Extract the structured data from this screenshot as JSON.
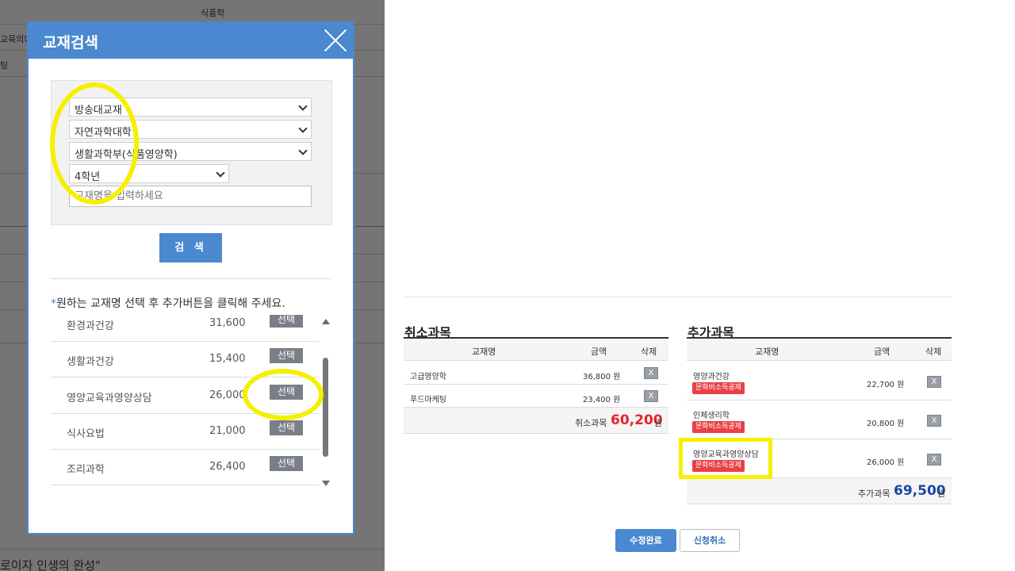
{
  "background": {
    "col_header": "식품학",
    "row_text_1": "교육의미",
    "row_text_2": "팅",
    "bottom_text": "로이자 인생의 완성\""
  },
  "modal": {
    "title": "교재검색",
    "close_icon": "close-icon",
    "filters": {
      "type": "방송대교재",
      "college": "자연과학대학",
      "department": "생활과학부(식품영양학)",
      "grade": "4학년"
    },
    "search_placeholder": "교재명을 입력하세요",
    "search_button": "검 색",
    "instruction_star": "*",
    "instruction": "원하는 교재명 선택 후 추가버튼을 클릭해 주세요.",
    "books": [
      {
        "name": "환경과건강",
        "price": "31,600",
        "select_label": "선택"
      },
      {
        "name": "생활과건강",
        "price": "15,400",
        "select_label": "선택"
      },
      {
        "name": "영양교육과영양상담",
        "price": "26,000",
        "select_label": "선택"
      },
      {
        "name": "식사요법",
        "price": "21,000",
        "select_label": "선택"
      },
      {
        "name": "조리과학",
        "price": "26,400",
        "select_label": "선택"
      }
    ]
  },
  "cancel_section": {
    "title": "취소과목",
    "headers": {
      "name": "교재명",
      "price": "금액",
      "delete": "삭제"
    },
    "rows": [
      {
        "name": "고급영양학",
        "price": "36,800 원",
        "delete_label": "X"
      },
      {
        "name": "푸드마케팅",
        "price": "23,400 원",
        "delete_label": "X"
      }
    ],
    "total_label": "취소과목",
    "total_value": "60,200",
    "total_unit": "원",
    "total_color": "#e8232a"
  },
  "add_section": {
    "title": "추가과목",
    "headers": {
      "name": "교재명",
      "price": "금액",
      "delete": "삭제"
    },
    "rows": [
      {
        "name": "영양과건강",
        "badge": "문화비소득공제",
        "price": "22,700 원",
        "delete_label": "X"
      },
      {
        "name": "인체생리학",
        "badge": "문화비소득공제",
        "price": "20,800 원",
        "delete_label": "X"
      },
      {
        "name": "영양교육과영양상담",
        "badge": "문화비소득공제",
        "price": "26,000 원",
        "delete_label": "X"
      }
    ],
    "total_label": "추가과목",
    "total_value": "69,500",
    "total_unit": "원",
    "total_color": "#1a47a8"
  },
  "actions": {
    "confirm": "수정완료",
    "cancel": "신청취소"
  },
  "colors": {
    "accent": "#4a88d0",
    "highlight": "#f4f000",
    "badge": "#ea3f46"
  }
}
